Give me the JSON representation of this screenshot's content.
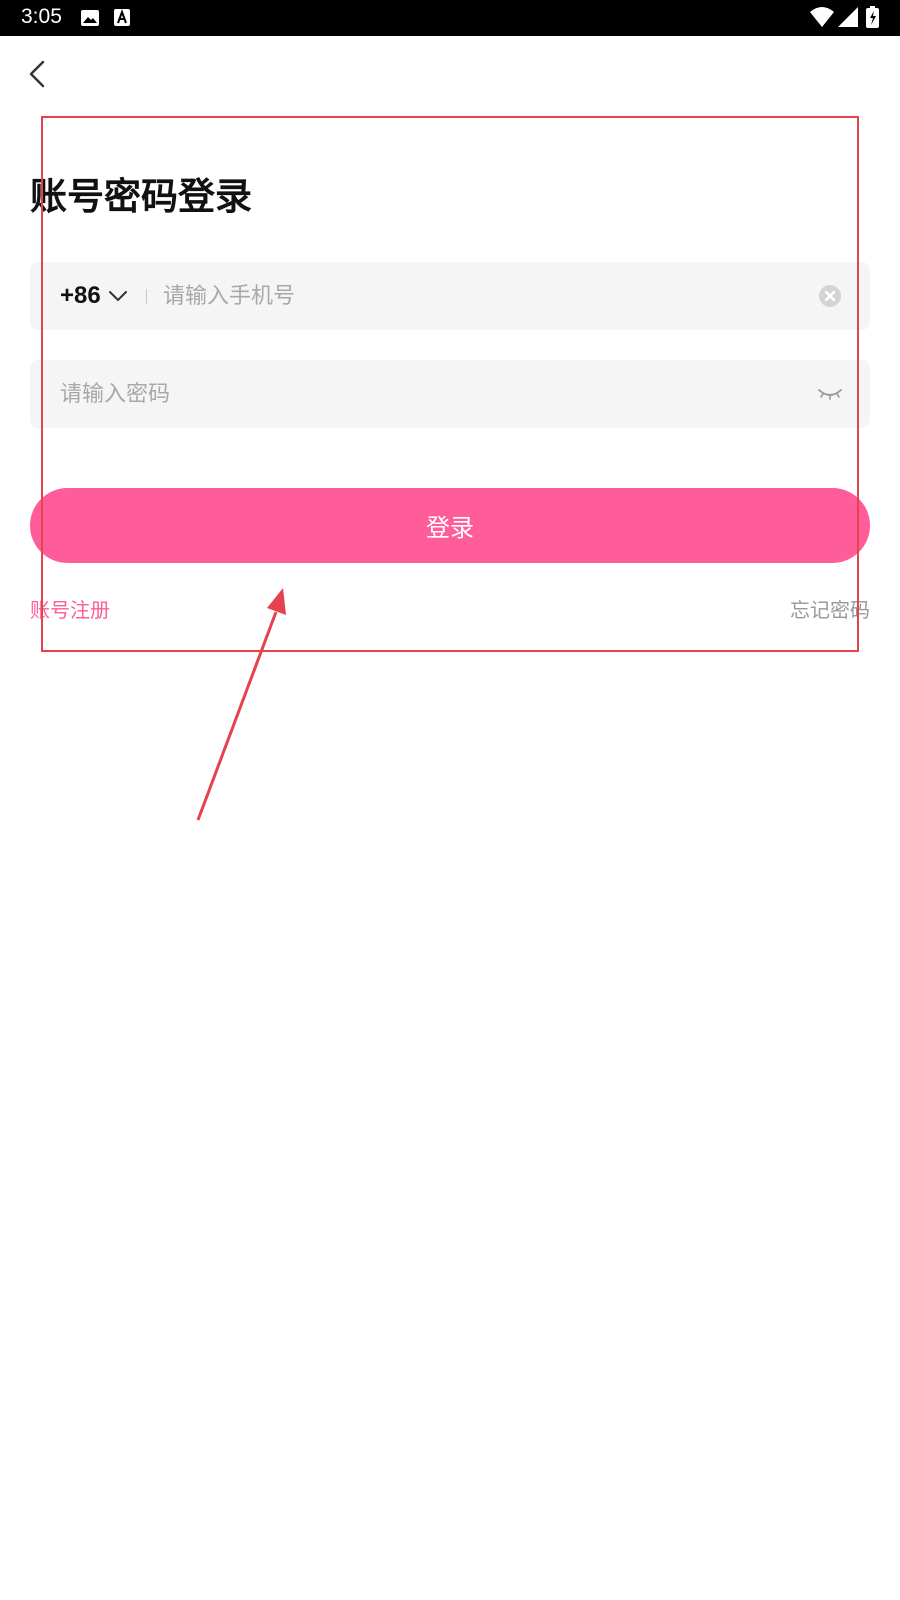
{
  "status_bar": {
    "time": "3:05",
    "icons": [
      "image-icon",
      "a-letter-icon",
      "wifi-icon",
      "signal-icon",
      "battery-charging-icon"
    ]
  },
  "header": {
    "back_icon": "chevron-left-icon"
  },
  "title": "账号密码登录",
  "phone": {
    "country_code": "+86",
    "placeholder": "请输入手机号",
    "value": "",
    "clear_icon": "clear-icon"
  },
  "password": {
    "placeholder": "请输入密码",
    "value": "",
    "visibility_icon": "eye-closed-icon"
  },
  "login_button": {
    "label": "登录"
  },
  "links": {
    "register": "账号注册",
    "forgot_password": "忘记密码"
  },
  "colors": {
    "accent": "#ff5c9a",
    "field_bg": "#f5f5f5",
    "annotation": "#e5424d"
  }
}
